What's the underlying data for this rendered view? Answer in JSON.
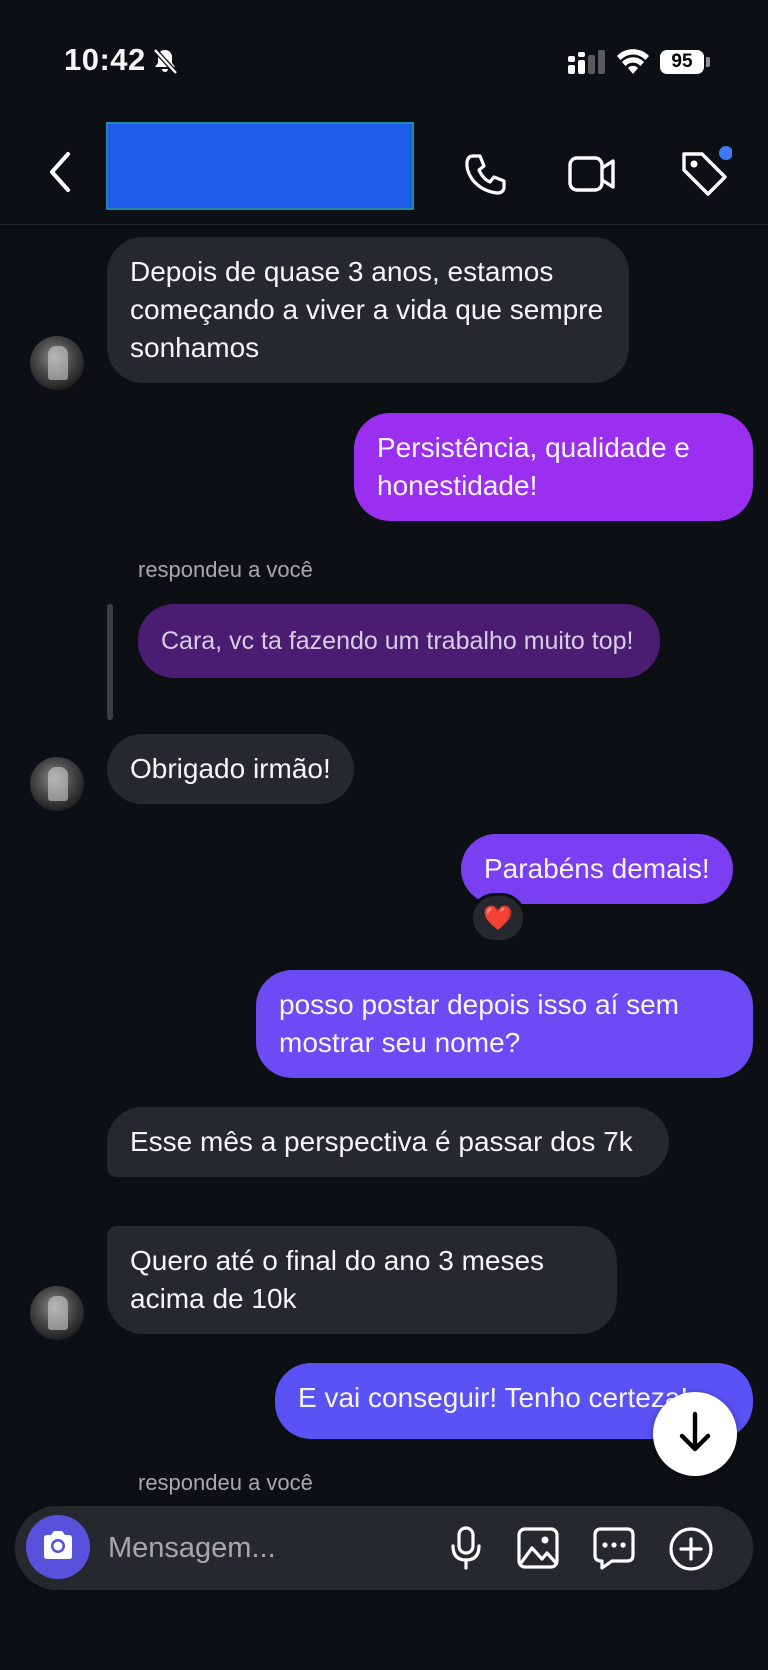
{
  "status_bar": {
    "time": "10:42",
    "battery": "95"
  },
  "header": {
    "contact_name_redacted": true
  },
  "messages": [
    {
      "text": "Depois de quase 3 anos, estamos começando a viver a vida que sempre sonhamos",
      "sender": "them"
    },
    {
      "text": "Persistência, qualidade e honestidade!",
      "sender": "me"
    },
    {
      "text": "respondeu a você",
      "type": "reply_label"
    },
    {
      "text": "Cara, vc ta fazendo um trabalho muito top!",
      "type": "quoted"
    },
    {
      "text": "Obrigado irmão!",
      "sender": "them"
    },
    {
      "text": "Parabéns demais!",
      "sender": "me",
      "reaction": "❤️"
    },
    {
      "text": "posso postar depois isso aí sem mostrar seu nome?",
      "sender": "me"
    },
    {
      "text": "Esse mês a perspectiva é passar dos 7k",
      "sender": "them"
    },
    {
      "text": "Quero até o final do ano 3 meses acima de 10k",
      "sender": "them"
    },
    {
      "text": "E vai conseguir! Tenho certeza!",
      "sender": "me"
    },
    {
      "text": "respondeu a você",
      "type": "reply_label"
    }
  ],
  "composer": {
    "placeholder": "Mensagem..."
  },
  "colors": {
    "background": "#0c1014",
    "incoming": "#25292e",
    "outgoing_top": "#9b2ff0",
    "outgoing_bottom": "#5a52f5",
    "camera_button": "#5851db"
  },
  "icons": [
    "bell-slash-icon",
    "cellular-icon",
    "wifi-icon",
    "back-chevron-icon",
    "phone-icon",
    "video-icon",
    "tag-icon",
    "camera-icon",
    "microphone-icon",
    "gallery-icon",
    "sticker-icon",
    "plus-circle-icon",
    "arrow-down-icon"
  ]
}
